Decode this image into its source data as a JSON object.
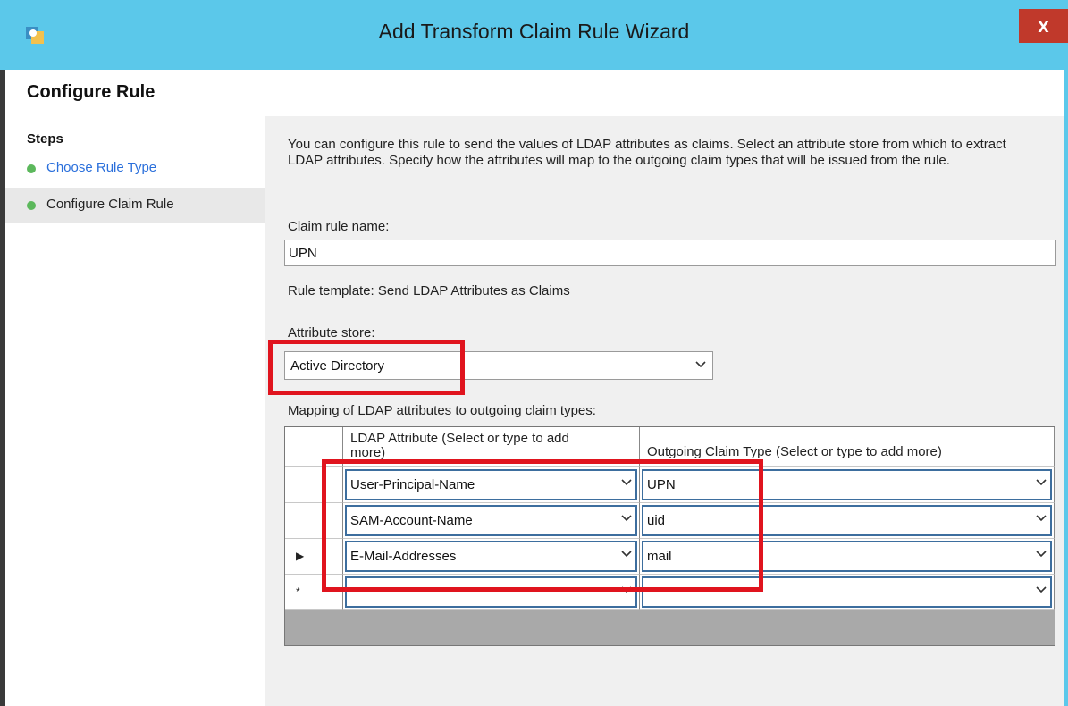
{
  "window": {
    "title": "Add Transform Claim Rule Wizard",
    "close_glyph": "x"
  },
  "header": {
    "title": "Configure Rule"
  },
  "sidebar": {
    "steps_label": "Steps",
    "items": [
      {
        "label": "Choose Rule Type"
      },
      {
        "label": "Configure Claim Rule"
      }
    ]
  },
  "main": {
    "description": "You can configure this rule to send the values of LDAP attributes as claims. Select an attribute store from which to extract LDAP attributes. Specify how the attributes will map to the outgoing claim types that will be issued from the rule.",
    "claim_rule_name_label": "Claim rule name:",
    "claim_rule_name_value": "UPN",
    "rule_template": "Rule template: Send LDAP Attributes as Claims",
    "attribute_store_label": "Attribute store:",
    "attribute_store_value": "Active Directory",
    "mapping_label": "Mapping of LDAP attributes to outgoing claim types:",
    "table": {
      "headers": [
        "LDAP Attribute (Select or type to add more)",
        "Outgoing Claim Type (Select or type to add more)"
      ],
      "rows": [
        {
          "marker": "",
          "ldap": "User-Principal-Name",
          "claim": "UPN"
        },
        {
          "marker": "",
          "ldap": "SAM-Account-Name",
          "claim": "uid"
        },
        {
          "marker": "▶",
          "ldap": "E-Mail-Addresses",
          "claim": "mail"
        },
        {
          "marker": "*",
          "ldap": "",
          "claim": ""
        }
      ]
    }
  },
  "colors": {
    "title_bar": "#5bc8ea",
    "highlight": "#e0141e",
    "step_dot": "#5cb85c",
    "link": "#2a6fdb"
  }
}
